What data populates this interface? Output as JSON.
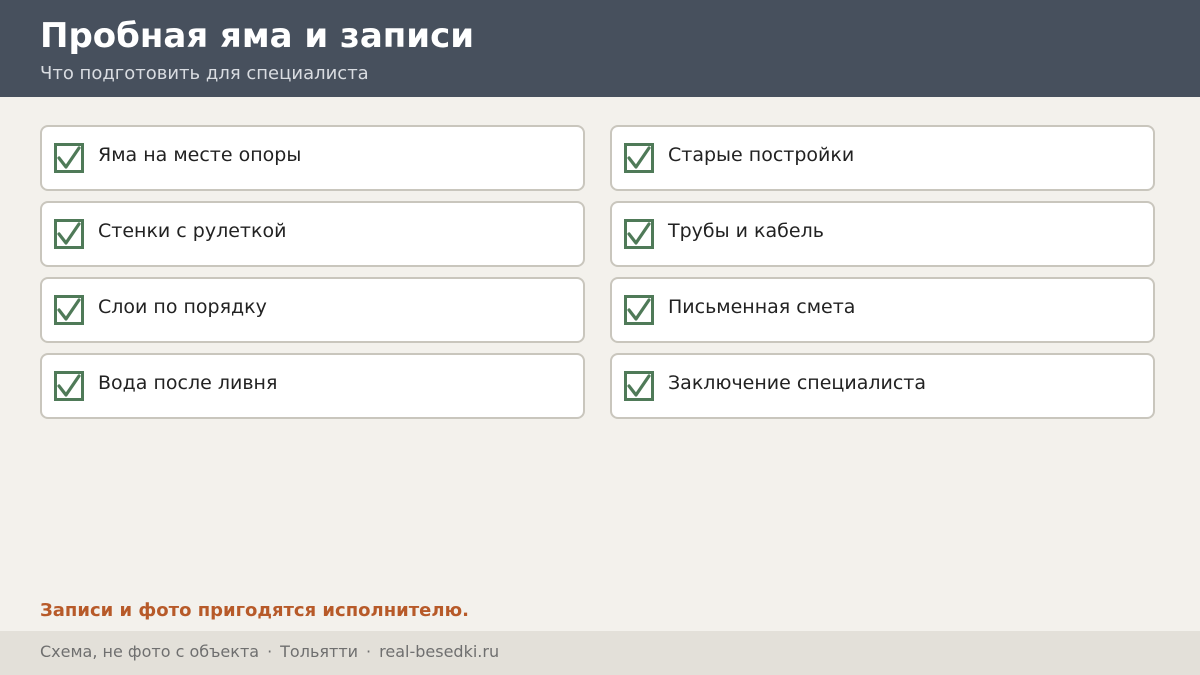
{
  "header": {
    "title": "Пробная яма и записи",
    "subtitle": "Что подготовить для специалиста"
  },
  "checklist": {
    "left": [
      {
        "label": "Яма на месте опоры",
        "checked": true
      },
      {
        "label": "Стенки с рулеткой",
        "checked": true
      },
      {
        "label": "Слои по порядку",
        "checked": true
      },
      {
        "label": "Вода после ливня",
        "checked": true
      }
    ],
    "right": [
      {
        "label": "Старые постройки",
        "checked": true
      },
      {
        "label": "Трубы и кабель",
        "checked": true
      },
      {
        "label": "Письменная смета",
        "checked": true
      },
      {
        "label": "Заключение специалиста",
        "checked": true
      }
    ]
  },
  "note": "Записи и фото пригодятся исполнителю.",
  "footer": {
    "items": [
      "Схема, не фото с объекта",
      "Тольятти",
      "real-besedki.ru"
    ],
    "separator": "·"
  },
  "colors": {
    "header_bg": "#47505d",
    "check_green": "#4f7a58",
    "note_accent": "#b75a29"
  },
  "icons": {
    "checkbox": "checkbox-checked-icon"
  }
}
